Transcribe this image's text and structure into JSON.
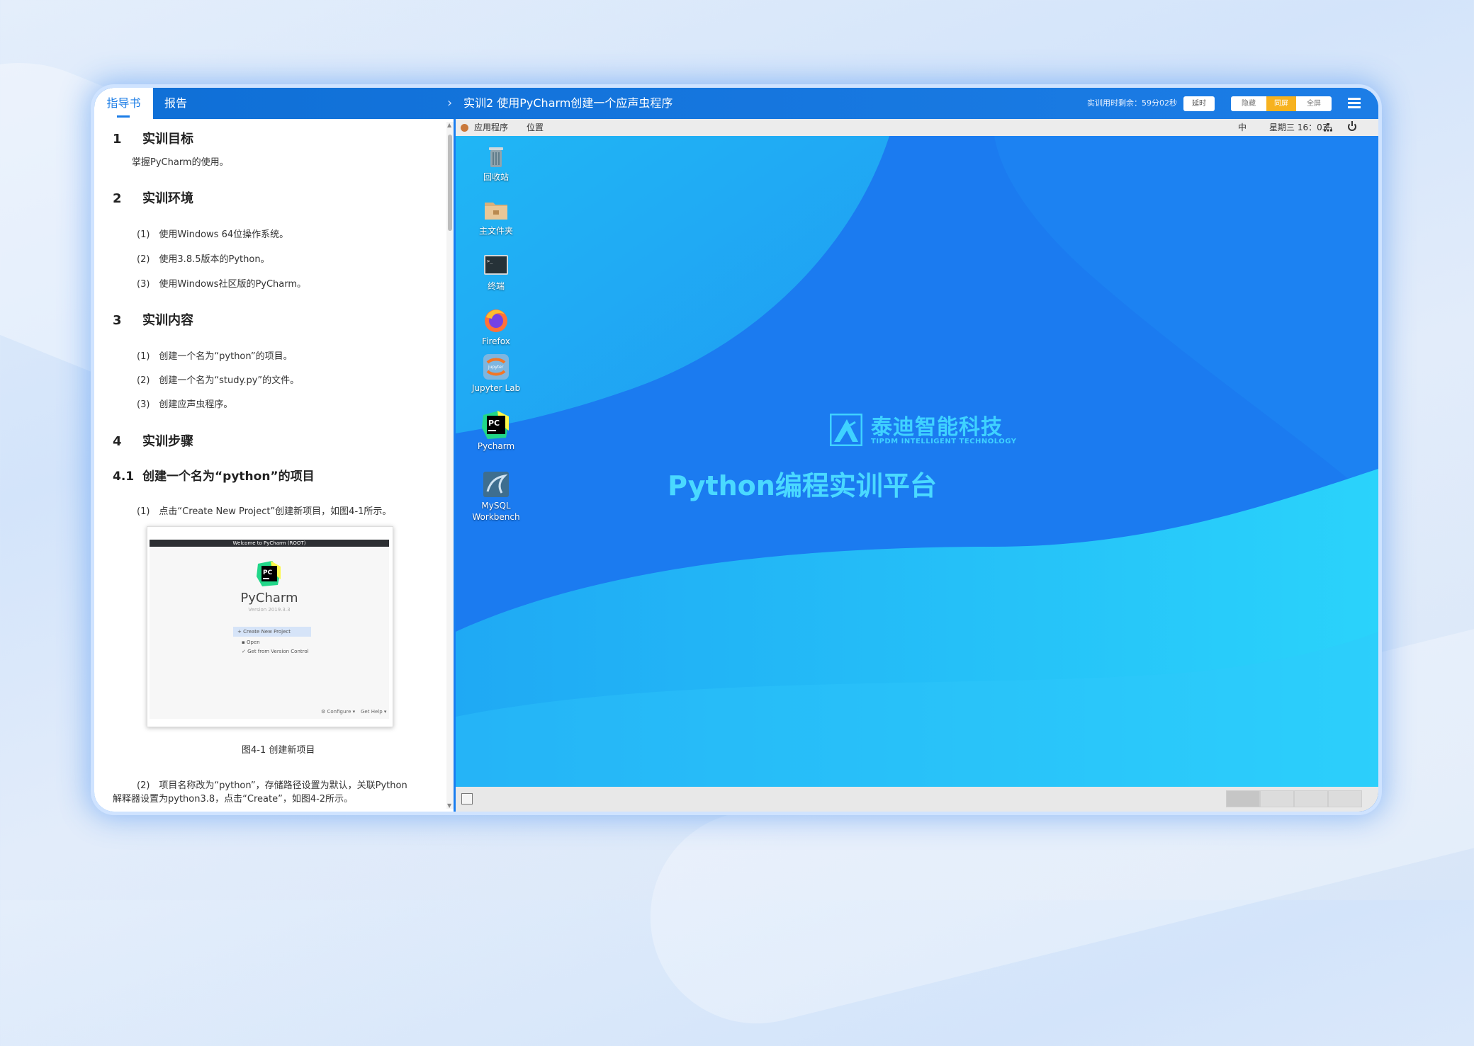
{
  "header": {
    "tabs": [
      "指导书",
      "报告"
    ],
    "lab_title": "实训2 使用PyCharm创建一个应声虫程序",
    "timer_text": "实训用时剩余：59分02秒",
    "extend_label": "延时",
    "hide_label": "隐藏",
    "sync_label": "同屏",
    "fullscreen_label": "全屏"
  },
  "guide": {
    "sections": [
      {
        "num": "1",
        "title": "实训目标"
      },
      {
        "num": "2",
        "title": "实训环境"
      },
      {
        "num": "3",
        "title": "实训内容"
      },
      {
        "num": "4",
        "title": "实训步骤"
      },
      {
        "num": "4.1",
        "title": "创建一个名为“python”的项目"
      }
    ],
    "goal_text": "掌握PyCharm的使用。",
    "env_items": [
      "(1)　使用Windows 64位操作系统。",
      "(2)　使用3.8.5版本的Python。",
      "(3)　使用Windows社区版的PyCharm。"
    ],
    "content_items": [
      "(1)　创建一个名为“python”的项目。",
      "(2)　创建一个名为“study.py”的文件。",
      "(3)　创建应声虫程序。"
    ],
    "step1": "(1)　点击“Create New Project”创建新项目，如图4-1所示。",
    "figure": {
      "window_title": "Welcome to PyCharm (ROOT)",
      "app_name": "PyCharm",
      "version": "Version 2019.3.3",
      "options": [
        "+ Create New Project",
        "Open",
        "Get from Version Control"
      ],
      "footer": [
        "⚙ Configure ▾",
        "Get Help ▾"
      ]
    },
    "caption": "图4-1 创建新项目",
    "step2_line1": "(2)　项目名称改为“python”，存储路径设置为默认，关联Python",
    "step2_line2": "解释器设置为python3.8，点击“Create”，如图4-2所示。"
  },
  "desktop": {
    "panel": {
      "apps": "应用程序",
      "places": "位置",
      "ime": "中",
      "clock": "星期三 16：03"
    },
    "icons": [
      "回收站",
      "主文件夹",
      "终端",
      "Firefox",
      "Jupyter Lab",
      "Pycharm",
      "MySQL\nWorkbench"
    ],
    "brand_cn": "泰迪智能科技",
    "brand_en": "TIPDM INTELLIGENT TECHNOLOGY",
    "platform": "Python编程实训平台"
  },
  "colors": {
    "accent": "#1c7de6",
    "sync": "#f7b21f",
    "brand": "#3fd2ff"
  }
}
